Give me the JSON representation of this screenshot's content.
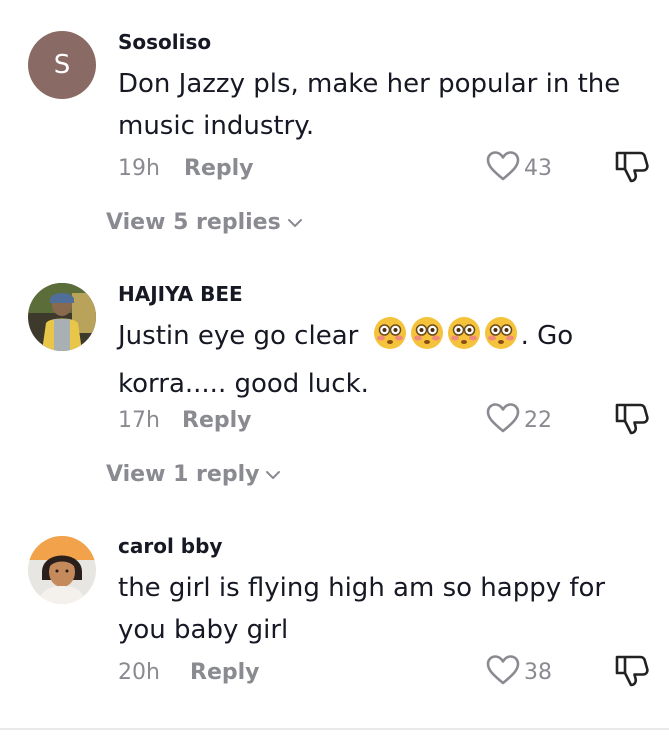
{
  "comments": [
    {
      "avatar_letter": "S",
      "username": "Sosoliso",
      "text_parts": [
        "Don Jazzy pls, make her popular in the",
        "music industry."
      ],
      "time": "19h",
      "reply_label": "Reply",
      "likes": "43",
      "view_replies": "View 5 replies"
    },
    {
      "username": "HAJIYA BEE",
      "text_before": "Justin eye go clear",
      "text_after": ". Go",
      "text_line2": "korra..... good luck.",
      "emoji_icons": [
        "flushed-face-icon",
        "flushed-face-icon",
        "flushed-face-icon",
        "flushed-face-icon"
      ],
      "time": "17h",
      "reply_label": "Reply",
      "likes": "22",
      "view_replies": "View 1 reply"
    },
    {
      "username": "carol bby",
      "text_parts": [
        "the girl is flying high am so happy for",
        "you baby girl"
      ],
      "time": "20h",
      "reply_label": "Reply",
      "likes": "38"
    }
  ],
  "icons": {
    "like": "heart-outline-icon",
    "dislike": "thumbs-down-icon",
    "expand": "chevron-down-icon"
  },
  "colors": {
    "text": "#161823",
    "secondary": "#8a8b91",
    "avatar_letter_bg": "#8a6a64"
  }
}
